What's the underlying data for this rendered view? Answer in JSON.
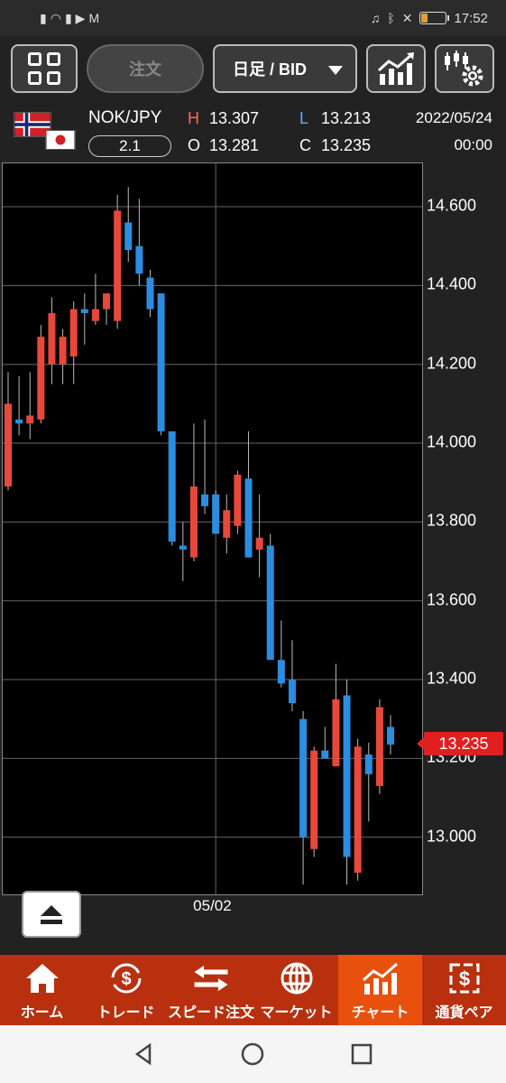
{
  "status": {
    "time": "17:52",
    "battery_level": 0.25
  },
  "toolbar": {
    "order_label": "注文",
    "period_label": "日足 / BID"
  },
  "info": {
    "pair": "NOK/JPY",
    "leverage": "2.1",
    "high_label": "H",
    "high": "13.307",
    "open_label": "O",
    "open": "13.281",
    "low_label": "L",
    "low": "13.213",
    "close_label": "C",
    "close": "13.235",
    "date": "2022/05/24",
    "time": "00:00"
  },
  "chart_data": {
    "type": "candlestick",
    "ylim": [
      12.855,
      14.71
    ],
    "yticks": [
      "14.600",
      "14.400",
      "14.200",
      "14.000",
      "13.800",
      "13.600",
      "13.400",
      "13.200",
      "13.000"
    ],
    "ytick_values": [
      14.6,
      14.4,
      14.2,
      14.0,
      13.8,
      13.6,
      13.4,
      13.2,
      13.0
    ],
    "xticks": [
      {
        "label": "05/02",
        "index": 19
      }
    ],
    "current_price": "13.235",
    "current_value": 13.235,
    "up_color": "#e8483a",
    "down_color": "#2b8de0",
    "candles": [
      {
        "o": 13.89,
        "h": 14.18,
        "l": 13.88,
        "c": 14.1
      },
      {
        "o": 14.06,
        "h": 14.17,
        "l": 14.02,
        "c": 14.05
      },
      {
        "o": 14.05,
        "h": 14.18,
        "l": 14.01,
        "c": 14.07
      },
      {
        "o": 14.06,
        "h": 14.3,
        "l": 14.05,
        "c": 14.27
      },
      {
        "o": 14.2,
        "h": 14.37,
        "l": 14.15,
        "c": 14.33
      },
      {
        "o": 14.2,
        "h": 14.29,
        "l": 14.15,
        "c": 14.27
      },
      {
        "o": 14.22,
        "h": 14.36,
        "l": 14.15,
        "c": 14.34
      },
      {
        "o": 14.34,
        "h": 14.38,
        "l": 14.25,
        "c": 14.33
      },
      {
        "o": 14.31,
        "h": 14.43,
        "l": 14.3,
        "c": 14.34
      },
      {
        "o": 14.34,
        "h": 14.38,
        "l": 14.3,
        "c": 14.38
      },
      {
        "o": 14.31,
        "h": 14.63,
        "l": 14.29,
        "c": 14.59
      },
      {
        "o": 14.56,
        "h": 14.65,
        "l": 14.46,
        "c": 14.49
      },
      {
        "o": 14.5,
        "h": 14.62,
        "l": 14.4,
        "c": 14.43
      },
      {
        "o": 14.42,
        "h": 14.44,
        "l": 14.32,
        "c": 14.34
      },
      {
        "o": 14.38,
        "h": 14.38,
        "l": 14.02,
        "c": 14.03
      },
      {
        "o": 14.03,
        "h": 13.99,
        "l": 13.74,
        "c": 13.75
      },
      {
        "o": 13.74,
        "h": 13.8,
        "l": 13.65,
        "c": 13.73
      },
      {
        "o": 13.71,
        "h": 14.05,
        "l": 13.7,
        "c": 13.89
      },
      {
        "o": 13.87,
        "h": 14.06,
        "l": 13.82,
        "c": 13.84
      },
      {
        "o": 13.87,
        "h": 13.88,
        "l": 13.8,
        "c": 13.77
      },
      {
        "o": 13.76,
        "h": 13.87,
        "l": 13.72,
        "c": 13.83
      },
      {
        "o": 13.79,
        "h": 13.93,
        "l": 13.77,
        "c": 13.92
      },
      {
        "o": 13.91,
        "h": 14.03,
        "l": 13.71,
        "c": 13.71
      },
      {
        "o": 13.73,
        "h": 13.87,
        "l": 13.66,
        "c": 13.76
      },
      {
        "o": 13.74,
        "h": 13.77,
        "l": 13.55,
        "c": 13.45
      },
      {
        "o": 13.45,
        "h": 13.55,
        "l": 13.38,
        "c": 13.39
      },
      {
        "o": 13.4,
        "h": 13.5,
        "l": 13.32,
        "c": 13.34
      },
      {
        "o": 13.3,
        "h": 13.32,
        "l": 12.88,
        "c": 13.0
      },
      {
        "o": 12.97,
        "h": 13.23,
        "l": 12.95,
        "c": 13.22
      },
      {
        "o": 13.22,
        "h": 13.28,
        "l": 13.2,
        "c": 13.2
      },
      {
        "o": 13.18,
        "h": 13.44,
        "l": 13.18,
        "c": 13.35
      },
      {
        "o": 13.36,
        "h": 13.4,
        "l": 12.88,
        "c": 12.95
      },
      {
        "o": 12.91,
        "h": 13.25,
        "l": 12.89,
        "c": 13.23
      },
      {
        "o": 13.21,
        "h": 13.24,
        "l": 13.04,
        "c": 13.16
      },
      {
        "o": 13.13,
        "h": 13.35,
        "l": 13.11,
        "c": 13.33
      },
      {
        "o": 13.28,
        "h": 13.31,
        "l": 13.21,
        "c": 13.235
      }
    ]
  },
  "nav": {
    "items": [
      {
        "label": "ホーム",
        "icon": "home-icon"
      },
      {
        "label": "トレード",
        "icon": "trade-icon"
      },
      {
        "label": "スピード注文",
        "icon": "speed-order-icon"
      },
      {
        "label": "マーケット",
        "icon": "globe-icon"
      },
      {
        "label": "チャート",
        "icon": "chart-icon"
      },
      {
        "label": "通貨ペア",
        "icon": "currency-pair-icon"
      }
    ],
    "active": 4
  }
}
